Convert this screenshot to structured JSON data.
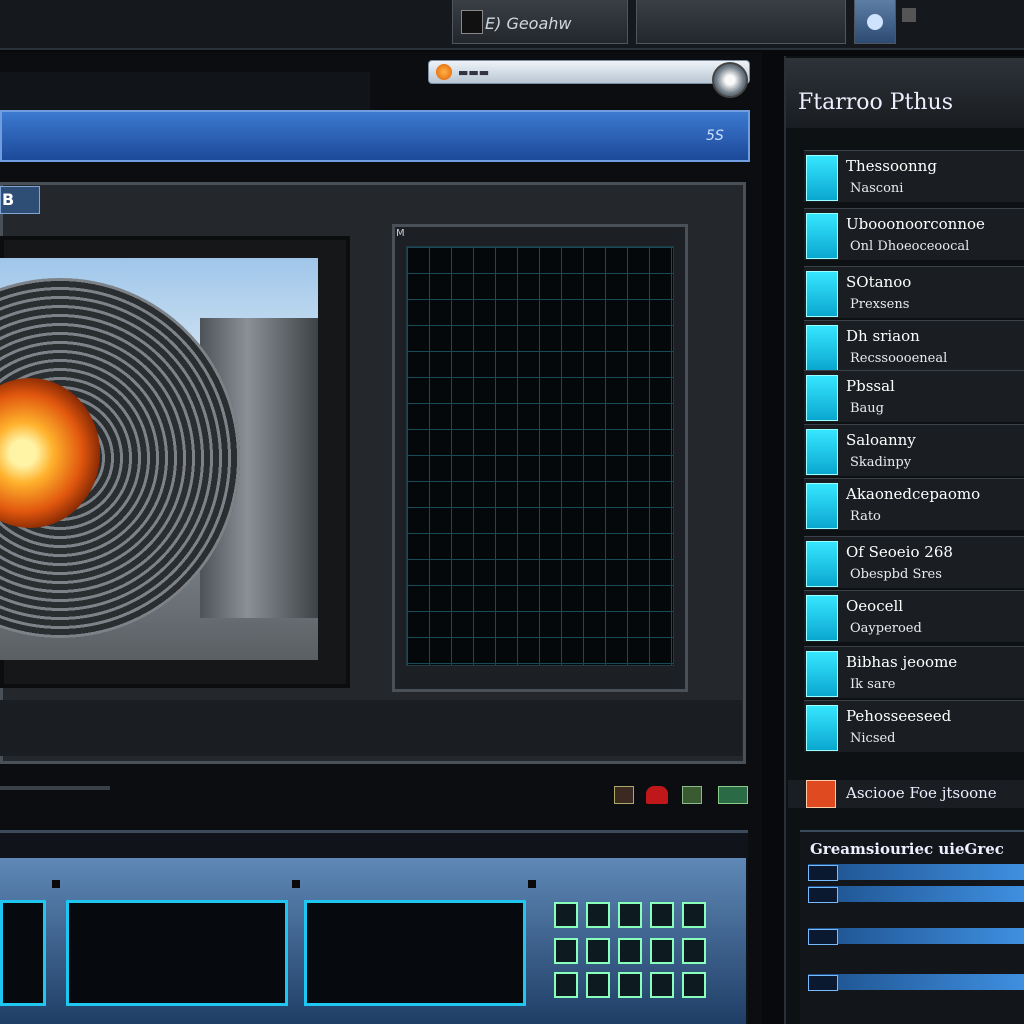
{
  "topbar": {
    "tab1_label": "E) Geoahw",
    "tab_icons": [
      "document-icon",
      "globe-icon"
    ]
  },
  "search": {
    "placeholder": "▬▬▬"
  },
  "bluebar": {
    "label": "5S"
  },
  "viewer": {
    "tab_label": "B",
    "grid_header": "M"
  },
  "right_panel": {
    "title": "Ftarroo Pthus",
    "rows": [
      {
        "title": "Thessoonng",
        "sub": "Nasconi"
      },
      {
        "title": "Ubooonoorconnoe",
        "sub": "Onl Dhoeoceoocal"
      },
      {
        "title": "SOtanoo",
        "sub": "Prexsens"
      },
      {
        "title": "Dh sriaon",
        "sub": "Recssoooeneal"
      },
      {
        "title": "Pbssal",
        "sub": "Baug"
      },
      {
        "title": "Saloanny",
        "sub": "Skadinpy"
      },
      {
        "title": "Akaonedcepaomo",
        "sub": "Rato"
      },
      {
        "title": "Of Seoeio 268",
        "sub": "Obespbd Sres"
      },
      {
        "title": "Oeocell",
        "sub": "Oayperoed"
      },
      {
        "title": "Bibhas jeoome",
        "sub": "Ik sare"
      },
      {
        "title": "Pehosseeseed",
        "sub": "Nicsed"
      }
    ],
    "footer_text": "Asciooe Foe jtsoone",
    "list_title": "Greamsiouriec uieGrec"
  }
}
